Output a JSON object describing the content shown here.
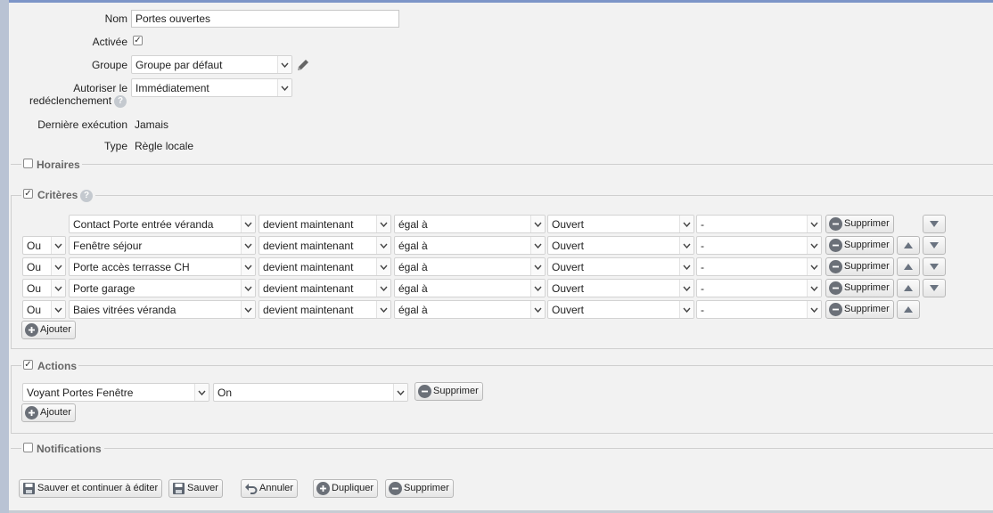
{
  "form": {
    "name_label": "Nom",
    "name_value": "Portes ouvertes",
    "enabled_label": "Activée",
    "enabled_checked": true,
    "group_label": "Groupe",
    "group_value": "Groupe par défaut",
    "retrigger_label_line1": "Autoriser le",
    "retrigger_label_line2": "redéclenchement",
    "retrigger_value": "Immédiatement",
    "last_exec_label": "Dernière exécution",
    "last_exec_value": "Jamais",
    "type_label": "Type",
    "type_value": "Règle locale"
  },
  "sections": {
    "schedules": "Horaires",
    "criteria": "Critères",
    "actions": "Actions",
    "notifications": "Notifications"
  },
  "criteria": {
    "rows": [
      {
        "connector": "",
        "device": "Contact Porte entrée véranda",
        "event": "devient maintenant",
        "operator": "égal à",
        "value": "Ouvert",
        "extra": "-",
        "up": false,
        "down": true
      },
      {
        "connector": "Ou",
        "device": "Fenêtre séjour",
        "event": "devient maintenant",
        "operator": "égal à",
        "value": "Ouvert",
        "extra": "-",
        "up": true,
        "down": true
      },
      {
        "connector": "Ou",
        "device": "Porte accès terrasse CH",
        "event": "devient maintenant",
        "operator": "égal à",
        "value": "Ouvert",
        "extra": "-",
        "up": true,
        "down": true
      },
      {
        "connector": "Ou",
        "device": "Porte garage",
        "event": "devient maintenant",
        "operator": "égal à",
        "value": "Ouvert",
        "extra": "-",
        "up": true,
        "down": true
      },
      {
        "connector": "Ou",
        "device": "Baies vitrées véranda",
        "event": "devient maintenant",
        "operator": "égal à",
        "value": "Ouvert",
        "extra": "-",
        "up": true,
        "down": false
      }
    ],
    "delete_label": "Supprimer",
    "add_label": "Ajouter"
  },
  "actions": {
    "device": "Voyant Portes Fenêtre",
    "value": "On",
    "delete_label": "Supprimer",
    "add_label": "Ajouter"
  },
  "footer": {
    "save_continue": "Sauver et continuer à éditer",
    "save": "Sauver",
    "cancel": "Annuler",
    "duplicate": "Dupliquer",
    "delete": "Supprimer"
  }
}
